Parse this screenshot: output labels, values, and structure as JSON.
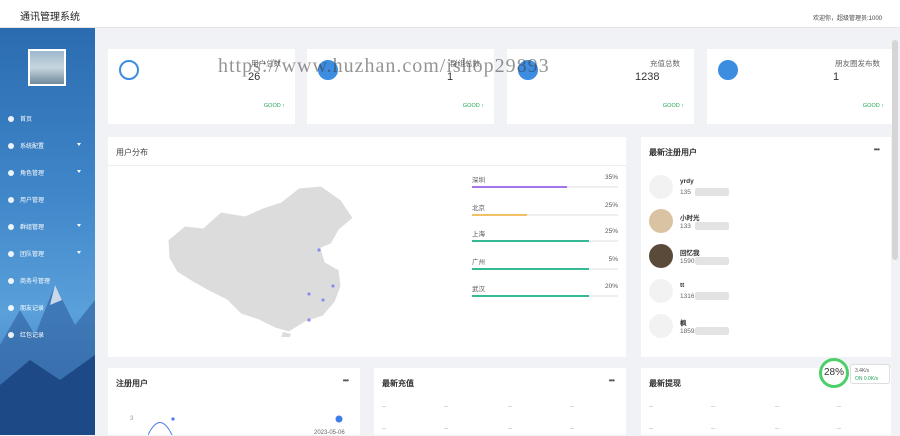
{
  "app": {
    "title": "通讯管理系统",
    "welcome": "欢迎你，超级管理员:1000"
  },
  "sidebar": {
    "items": [
      {
        "label": "首页",
        "icon": "home-icon",
        "has_caret": false
      },
      {
        "label": "系统配置",
        "icon": "gear-icon",
        "has_caret": true
      },
      {
        "label": "角色管理",
        "icon": "role-icon",
        "has_caret": true
      },
      {
        "label": "用户管理",
        "icon": "user-icon",
        "has_caret": false
      },
      {
        "label": "群组管理",
        "icon": "group-icon",
        "has_caret": true
      },
      {
        "label": "团队管理",
        "icon": "team-icon",
        "has_caret": true
      },
      {
        "label": "商务号管理",
        "icon": "business-icon",
        "has_caret": false
      },
      {
        "label": "朋友记录",
        "icon": "chat-icon",
        "has_caret": false
      },
      {
        "label": "红包记录",
        "icon": "redpacket-icon",
        "has_caret": false
      }
    ]
  },
  "stats": [
    {
      "label": "用户总数",
      "value": "26",
      "good": "GOOD ↑",
      "icon": "user-circle-icon"
    },
    {
      "label": "群组总数",
      "value": "1",
      "good": "GOOD ↑",
      "icon": "group-circle-icon"
    },
    {
      "label": "充值总数",
      "value": "1238",
      "good": "GOOD ↑",
      "icon": "chart-circle-icon"
    },
    {
      "label": "朋友圈发布数",
      "value": "1",
      "good": "GOOD ↑",
      "icon": "heart-circle-icon"
    }
  ],
  "watermark": "https://www.huzhan.com/ishop29893",
  "distribution": {
    "title": "用户分布",
    "cities": [
      {
        "name": "深圳",
        "pct": "35%",
        "fill": 0.65,
        "color": "#a574e8"
      },
      {
        "name": "北京",
        "pct": "25%",
        "fill": 0.38,
        "color": "#f2c166"
      },
      {
        "name": "上海",
        "pct": "25%",
        "fill": 0.8,
        "color": "#35b893"
      },
      {
        "name": "广州",
        "pct": "5%",
        "fill": 0.8,
        "color": "#35b893"
      },
      {
        "name": "武汉",
        "pct": "20%",
        "fill": 0.8,
        "color": "#35b893"
      }
    ]
  },
  "latest_users": {
    "title": "最新注册用户",
    "more": "•••",
    "users": [
      {
        "name": "yrdy",
        "phone": "135"
      },
      {
        "name": "小时光",
        "phone": "133"
      },
      {
        "name": "回忆我",
        "phone": "1590"
      },
      {
        "name": "tt",
        "phone": "1316"
      },
      {
        "name": "枫",
        "phone": "18592"
      }
    ]
  },
  "registered": {
    "title": "注册用户",
    "more": "•••",
    "y_tick": "3",
    "date": "2023-05-06"
  },
  "recharge": {
    "title": "最新充值",
    "more": "•••",
    "cell": "--"
  },
  "withdraw": {
    "title": "最新提现",
    "more": "•••",
    "cell": "--"
  },
  "badge": {
    "percent": "28%",
    "speed": "3.4K/s",
    "status": "ON 0.0K/s"
  }
}
